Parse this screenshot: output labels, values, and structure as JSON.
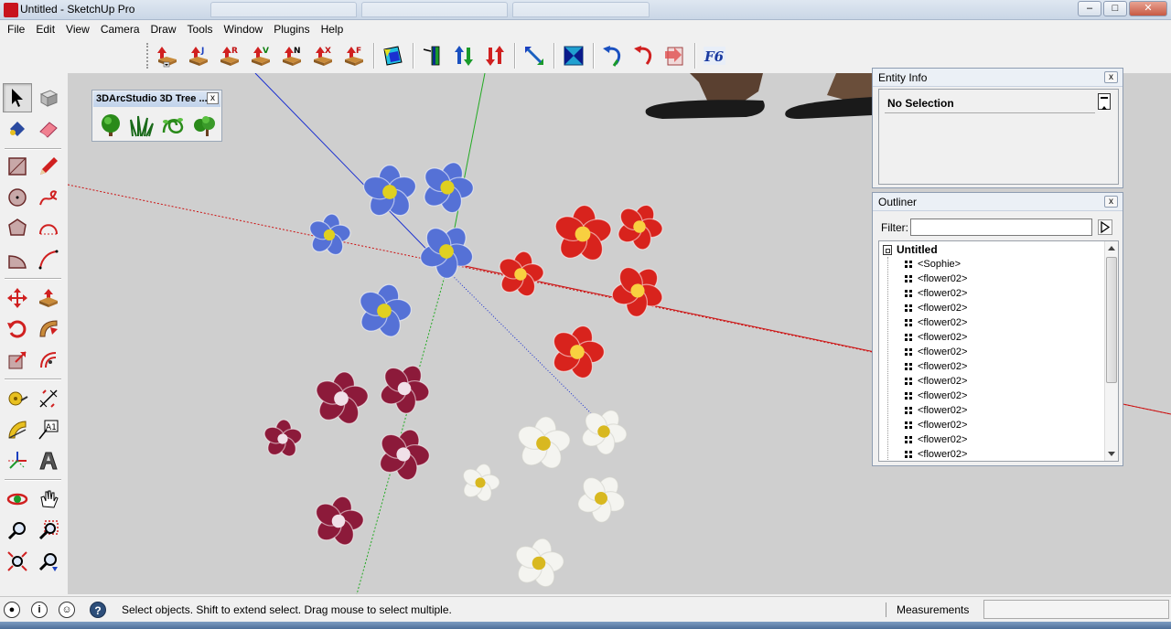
{
  "window": {
    "title": "Untitled - SketchUp Pro",
    "controls": [
      "minimize",
      "maximize",
      "close"
    ]
  },
  "menu": [
    "File",
    "Edit",
    "View",
    "Camera",
    "Draw",
    "Tools",
    "Window",
    "Plugins",
    "Help"
  ],
  "top_toolbar": {
    "icons": [
      "add-j-icon",
      "add-r-icon",
      "add-v-icon",
      "add-n-icon",
      "add-x-icon",
      "add-f-icon",
      "layer-shape-icon",
      "axis-icon",
      "swap-up-down-icon",
      "swap-red-icon",
      "scale-diagonal-icon",
      "hourglass-icon",
      "undo-blue-icon",
      "undo-red-icon",
      "export-icon",
      "f6-icon"
    ],
    "f6_label": "F6"
  },
  "left_toolbar": {
    "tools": [
      [
        "select-icon",
        "component-icon"
      ],
      [
        "paint-bucket-icon",
        "eraser-icon"
      ],
      [
        "rectangle-icon",
        "pencil-icon"
      ],
      [
        "circle-icon",
        "freehand-icon"
      ],
      [
        "polygon-icon",
        "arc-icon"
      ],
      [
        "pie-icon",
        "arc2-icon"
      ],
      [
        "move-icon",
        "push-pull-icon"
      ],
      [
        "rotate-icon",
        "follow-me-icon"
      ],
      [
        "scale-icon",
        "offset-icon"
      ],
      [
        "tape-measure-icon",
        "dimension-icon"
      ],
      [
        "protractor-icon",
        "text-label-icon"
      ],
      [
        "axes-icon",
        "3d-text-icon"
      ],
      [
        "orbit-icon",
        "pan-icon"
      ],
      [
        "zoom-icon",
        "zoom-window-icon"
      ],
      [
        "zoom-extents-icon",
        "previous-view-icon"
      ]
    ],
    "text_tool_label": "A1"
  },
  "tree_toolbar": {
    "title": "3DArcStudio 3D Tree ...",
    "close": "x",
    "icons": [
      "tree-icon",
      "grass-icon",
      "vine-icon",
      "bush-icon"
    ]
  },
  "entity_info": {
    "title": "Entity Info",
    "close": "x",
    "selection": "No Selection"
  },
  "outliner": {
    "title": "Outliner",
    "close": "x",
    "filter_label": "Filter:",
    "filter_value": "",
    "root": "Untitled",
    "items": [
      "<Sophie>",
      "<flower02>",
      "<flower02>",
      "<flower02>",
      "<flower02>",
      "<flower02>",
      "<flower02>",
      "<flower02>",
      "<flower02>",
      "<flower02>",
      "<flower02>",
      "<flower02>",
      "<flower02>",
      "<flower02>"
    ]
  },
  "status": {
    "icons": [
      "geo-location-icon",
      "credits-icon",
      "user-icon",
      "help-icon"
    ],
    "message": "Select objects. Shift to extend select. Drag mouse to select multiple.",
    "measurements_label": "Measurements",
    "measurements_value": ""
  },
  "colors": {
    "viewport_bg": "#cfcfcf",
    "axis_red": "#cc1111",
    "axis_green": "#22aa22",
    "axis_blue": "#1a2fd0",
    "flower_blue": "#5571d6",
    "flower_red": "#d8231d",
    "flower_burgundy": "#8c1a3a",
    "flower_white": "#f4f4f0"
  }
}
